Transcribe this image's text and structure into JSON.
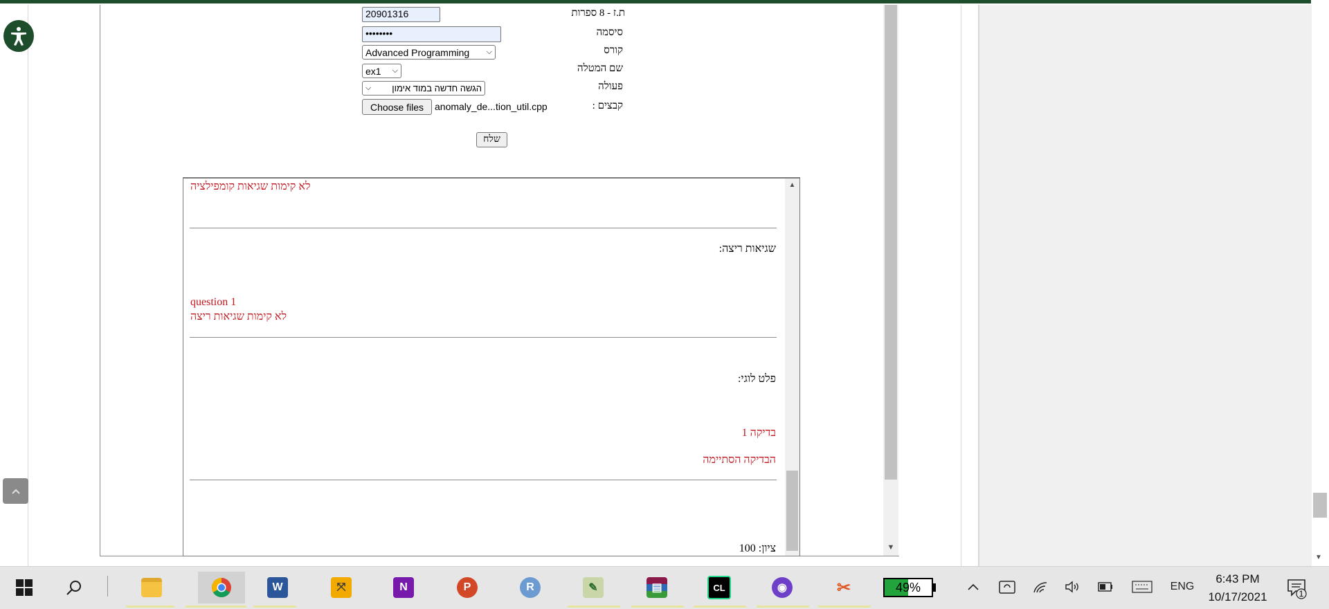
{
  "form": {
    "id_label": "ת.ז - 8 ספרות",
    "id_value": "20901316",
    "password_label": "סיסמה",
    "password_value": "••••••••",
    "course_label": "קורס",
    "course_value": "Advanced Programming",
    "task_label": "שם המטלה",
    "task_value": "ex1",
    "action_label": "פעולה",
    "action_value": "הגשה חדשה במוד אימון",
    "files_label": "קבצים :",
    "choose_files": "Choose files",
    "file_name": "anomaly_de...tion_util.cpp",
    "submit": "שלח"
  },
  "results": {
    "compile_status": "לא קימות שגיאות קומפילציה",
    "runtime_heading": "שגיאות ריצה:",
    "question": "question 1",
    "runtime_status": "לא קימות שגיאות ריצה",
    "output_heading": "פלט לוגי:",
    "check_label": "בדיקה 1",
    "check_done": "הבדיקה הסתיימה",
    "grade": "ציון: 100"
  },
  "taskbar": {
    "apps": [
      "start",
      "search",
      "file-explorer",
      "chrome",
      "word",
      "vmware",
      "onenote",
      "powerpoint",
      "r",
      "photo-editor",
      "winrar",
      "clion",
      "github",
      "snipping"
    ],
    "battery_percent": "49%",
    "language": "ENG",
    "time": "6:43 PM",
    "date": "10/17/2021",
    "notification_count": "1"
  },
  "colors": {
    "accent_green": "#1e4d2b",
    "result_red": "#c0141c",
    "battery_green": "#23a33c"
  }
}
